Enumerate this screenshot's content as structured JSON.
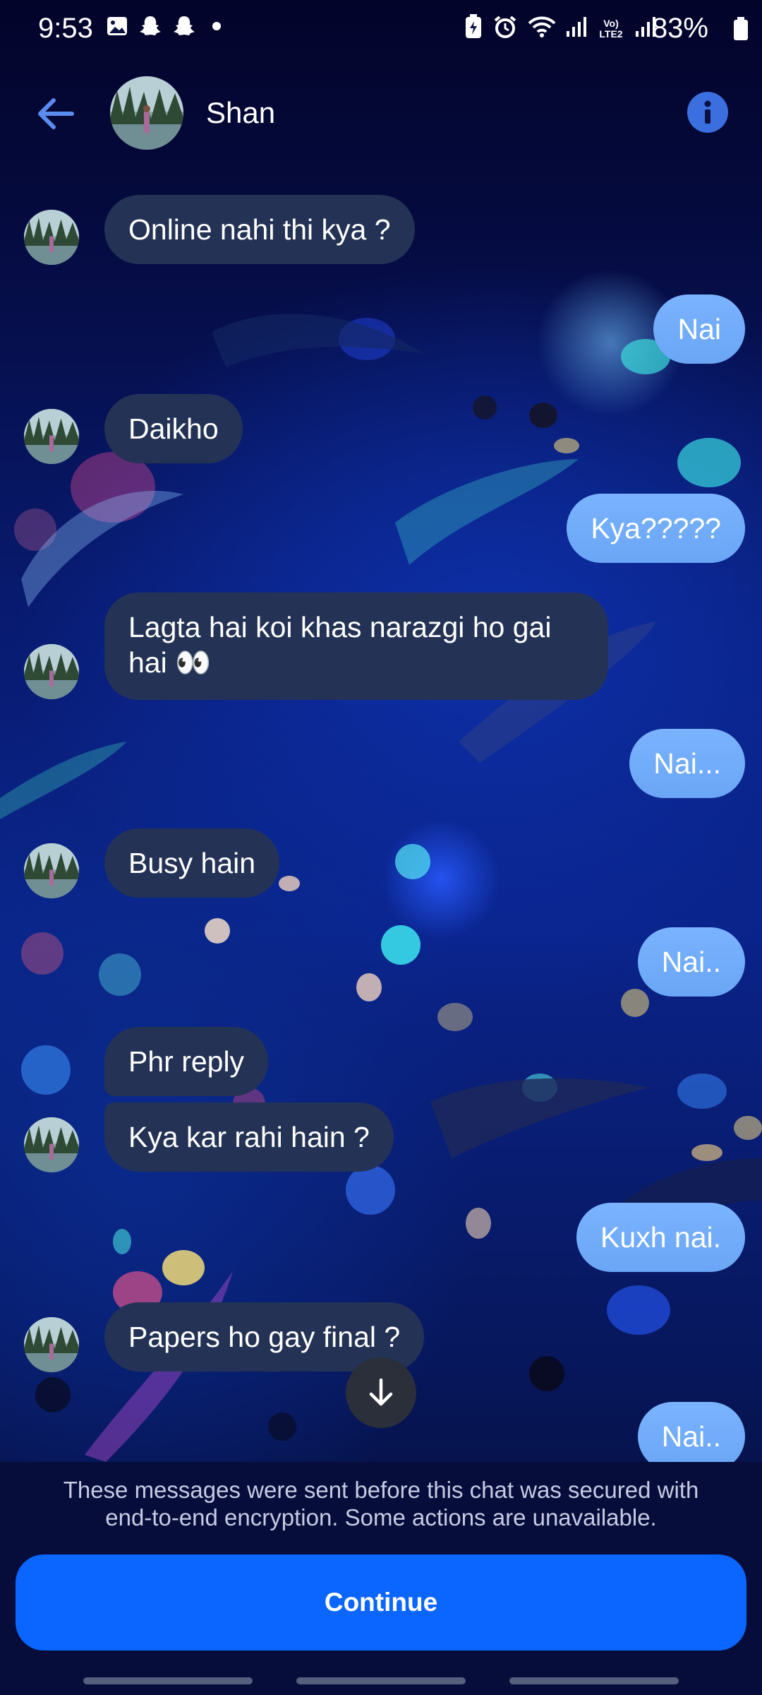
{
  "status_bar": {
    "time": "9:53",
    "battery": "83%",
    "icons": [
      "gallery-icon",
      "snapchat-icon",
      "snapchat-icon",
      "dot-icon",
      "battery-saver-icon",
      "alarm-icon",
      "wifi-icon",
      "signal-icon",
      "volte-icon",
      "signal-icon",
      "battery-icon"
    ],
    "volte_label": "Vo) LTE2"
  },
  "header": {
    "contact_name": "Shan",
    "back_icon": "arrow-left-icon",
    "info_icon": "info-icon"
  },
  "messages": [
    {
      "dir": "in",
      "text": "Online nahi thi kya ?"
    },
    {
      "dir": "out",
      "text": "Nai"
    },
    {
      "dir": "in",
      "text": "Daikho"
    },
    {
      "dir": "out",
      "text": "Kya?????"
    },
    {
      "dir": "in",
      "text": "Lagta hai koi khas narazgi ho gai hai 👀"
    },
    {
      "dir": "out",
      "text": "Nai..."
    },
    {
      "dir": "in",
      "text": "Busy hain"
    },
    {
      "dir": "out",
      "text": "Nai.."
    },
    {
      "dir": "in",
      "text": "Phr reply"
    },
    {
      "dir": "in",
      "text": "Kya kar rahi hain ?"
    },
    {
      "dir": "out",
      "text": "Kuxh nai."
    },
    {
      "dir": "in",
      "text": "Papers ho gay final ?"
    },
    {
      "dir": "out",
      "text": "Nai.."
    }
  ],
  "footer": {
    "notice": "These messages were sent before this chat was secured with end-to-end encryption. Some actions are unavailable.",
    "continue_label": "Continue"
  },
  "colors": {
    "incoming_bubble": "#243355",
    "outgoing_bubble": "#7ab3ff",
    "primary_button": "#0a66ff",
    "accent": "#3b6fe0"
  }
}
